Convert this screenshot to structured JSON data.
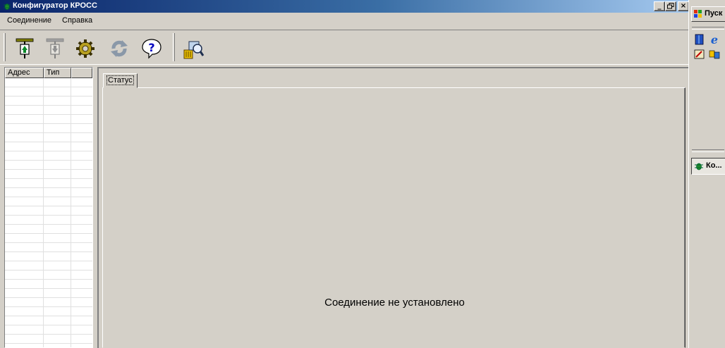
{
  "window": {
    "title": "Конфигуратор КРОСС",
    "controls": {
      "minimize": "_",
      "maximize": "ð",
      "close": "×"
    }
  },
  "menu": {
    "items": [
      "Соединение",
      "Справка"
    ]
  },
  "toolbar": {
    "buttons": [
      {
        "icon": "connect-icon",
        "enabled": true
      },
      {
        "icon": "disconnect-icon",
        "enabled": false
      },
      {
        "icon": "settings-gear-icon",
        "enabled": true
      },
      {
        "icon": "refresh-icon",
        "enabled": false
      },
      {
        "icon": "help-icon",
        "enabled": true
      },
      {
        "icon": "device-search-icon",
        "enabled": true
      }
    ]
  },
  "list": {
    "columns": [
      "Адрес",
      "Тип",
      ""
    ],
    "rows": []
  },
  "tabs": [
    {
      "label": "Статус",
      "active": true
    }
  ],
  "status": {
    "message": "Соединение не установлено"
  },
  "taskbar": {
    "start_label": "Пуск",
    "task_label": "Ко..."
  },
  "colors": {
    "face": "#d4d0c8",
    "title_start": "#0a246a",
    "title_end": "#a6caf0"
  }
}
